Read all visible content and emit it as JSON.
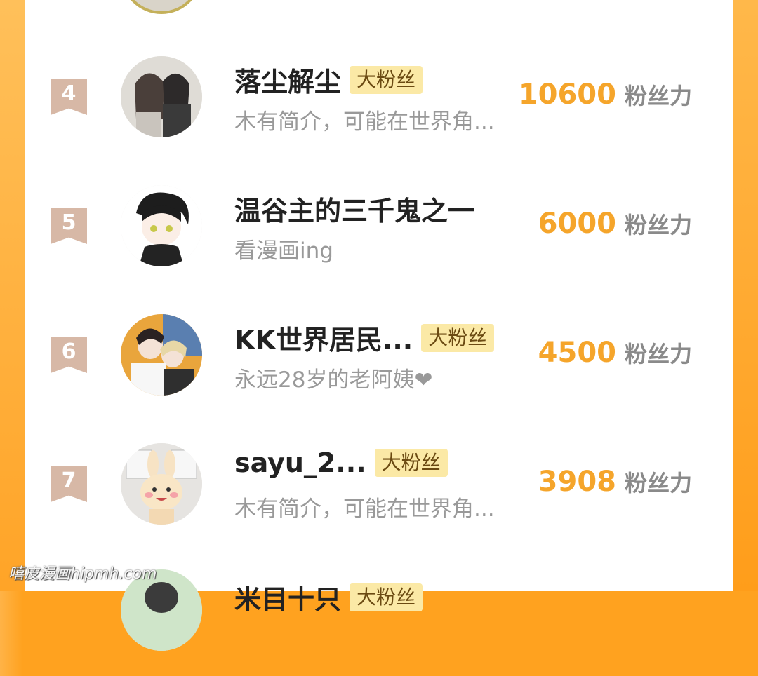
{
  "fans": [
    {
      "rank": "4",
      "name": "落尘解尘",
      "badge": "大粉丝",
      "desc": "木有简介，可能在世界角...",
      "score": "10600",
      "unit": "粉丝力",
      "avatar_icon": "avatar-illustrated-couple"
    },
    {
      "rank": "5",
      "name": "温谷主的三千鬼之一",
      "badge": "",
      "desc": "看漫画ing",
      "score": "6000",
      "unit": "粉丝力",
      "avatar_icon": "avatar-anime-boy"
    },
    {
      "rank": "6",
      "name": "KK世界居民...",
      "badge": "大粉丝",
      "desc": "永远28岁的老阿姨❤",
      "score": "4500",
      "unit": "粉丝力",
      "avatar_icon": "avatar-illustrated-couple-2"
    },
    {
      "rank": "7",
      "name": "sayu_2...",
      "badge": "大粉丝",
      "desc": "木有简介，可能在世界角...",
      "score": "3908",
      "unit": "粉丝力",
      "avatar_icon": "avatar-bunny-plush"
    },
    {
      "rank": "",
      "name": "米目十只",
      "badge": "大粉丝",
      "desc": "",
      "score": "",
      "unit": "",
      "avatar_icon": "avatar-partial"
    }
  ],
  "watermark": "嘻皮漫画hipmh.com",
  "colors": {
    "accent": "#f5a52b",
    "badge_bg": "#fbe9a6",
    "rank_ribbon": "#d7b8a6",
    "background": "#ffa21f"
  }
}
